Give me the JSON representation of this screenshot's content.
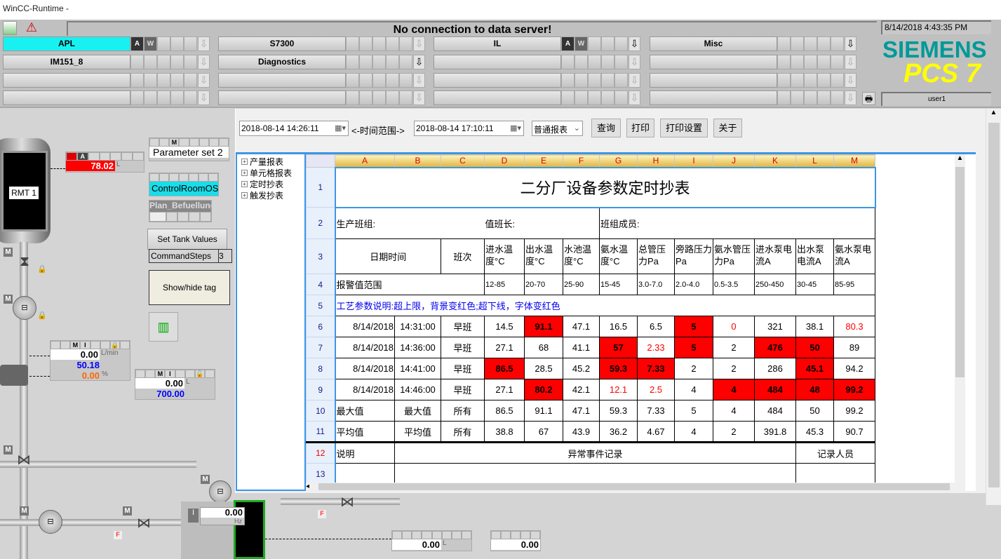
{
  "window": {
    "title": "WinCC-Runtime -"
  },
  "header": {
    "message": "No connection to data server!",
    "datetime": "8/14/2018 4:43:35 PM",
    "logo_brand": "SIEMENS",
    "logo_product": "PCS 7",
    "user": "user1",
    "accent_color": "#19f1f1",
    "groups": [
      [
        {
          "label": "APL",
          "active": true,
          "aw": true,
          "arrow_on": false
        },
        {
          "label": "IM151_8"
        },
        {
          "label": ""
        },
        {
          "label": ""
        }
      ],
      [
        {
          "label": "S7300"
        },
        {
          "label": "Diagnostics",
          "arrow_on": true
        },
        {
          "label": ""
        },
        {
          "label": ""
        }
      ],
      [
        {
          "label": "IL",
          "aw": true,
          "arrow_on": true
        },
        {
          "label": ""
        },
        {
          "label": ""
        },
        {
          "label": ""
        }
      ],
      [
        {
          "label": "Misc",
          "arrow_on": true
        },
        {
          "label": ""
        },
        {
          "label": ""
        },
        {
          "label": ""
        }
      ]
    ]
  },
  "hmi": {
    "tank_label": "RMT 1",
    "level_value": "78.02",
    "level_unit": "L",
    "parameter_set": "Parameter set 2",
    "control_room": "ControlRoomOS",
    "plan": "Plan_Befuellung",
    "set_tank_values": "Set Tank Values",
    "command_steps_label": "CommandSteps",
    "command_steps_value": "3",
    "show_hide_tag": "Show/hide tag",
    "flow": {
      "pv": "0.00",
      "sp": "50.18",
      "out": "0.00",
      "unit": "L/min",
      "out_unit": "%"
    },
    "volume": {
      "pv": "0.00",
      "sp": "700.00",
      "unit": "L"
    },
    "freq": {
      "value": "0.00",
      "unit": "Hz"
    },
    "bottom1": {
      "value": "0.00",
      "unit": "L"
    },
    "bottom2": {
      "value": "0.00"
    }
  },
  "report": {
    "start_time": "2018-08-14 14:26:11",
    "range_label": "<-时间范围->",
    "end_time": "2018-08-14 17:10:11",
    "report_type": "普通报表",
    "buttons": {
      "query": "查询",
      "print": "打印",
      "print_setup": "打印设置",
      "about": "关于"
    },
    "tree": [
      "产量报表",
      "单元格报表",
      "定时抄表",
      "触发抄表"
    ],
    "columns": [
      "A",
      "B",
      "C",
      "D",
      "E",
      "F",
      "G",
      "H",
      "I",
      "J",
      "K",
      "L",
      "M"
    ],
    "title": "二分厂设备参数定时抄表",
    "row2": {
      "group": "生产班组:",
      "leader": "值班长:",
      "members": "班组成员:"
    },
    "row3": {
      "datetime": "日期时间",
      "shift": "班次",
      "params": [
        "进水温度°C",
        "出水温度°C",
        "水池温度°C",
        "氨水温度°C",
        "总管压力Pa",
        "旁路压力Pa",
        "氨水管压力Pa",
        "进水泵电流A",
        "出水泵电流A",
        "氨水泵电流A"
      ]
    },
    "row4": {
      "label": "报警值范围",
      "ranges": [
        "12-85",
        "20-70",
        "25-90",
        "15-45",
        "3.0-7.0",
        "2.0-4.0",
        "0.5-3.5",
        "250-450",
        "30-45",
        "85-95"
      ]
    },
    "row5": {
      "note": "工艺参数说明:超上限，背景变红色;超下线，字体变红色"
    },
    "data_rows": [
      {
        "date": "8/14/2018",
        "time": "14:31:00",
        "shift": "早班",
        "values": [
          {
            "v": "14.5"
          },
          {
            "v": "91.1",
            "s": "hi"
          },
          {
            "v": "47.1"
          },
          {
            "v": "16.5"
          },
          {
            "v": "6.5"
          },
          {
            "v": "5",
            "s": "hi"
          },
          {
            "v": "0",
            "s": "lo"
          },
          {
            "v": "321"
          },
          {
            "v": "38.1"
          },
          {
            "v": "80.3",
            "s": "lo"
          }
        ]
      },
      {
        "date": "8/14/2018",
        "time": "14:36:00",
        "shift": "早班",
        "values": [
          {
            "v": "27.1"
          },
          {
            "v": "68"
          },
          {
            "v": "41.1"
          },
          {
            "v": "57",
            "s": "hi"
          },
          {
            "v": "2.33",
            "s": "lo"
          },
          {
            "v": "5",
            "s": "hi"
          },
          {
            "v": "2"
          },
          {
            "v": "476",
            "s": "hi"
          },
          {
            "v": "50",
            "s": "hi"
          },
          {
            "v": "89"
          }
        ]
      },
      {
        "date": "8/14/2018",
        "time": "14:41:00",
        "shift": "早班",
        "values": [
          {
            "v": "86.5",
            "s": "hi"
          },
          {
            "v": "28.5"
          },
          {
            "v": "45.2"
          },
          {
            "v": "59.3",
            "s": "hi"
          },
          {
            "v": "7.33",
            "s": "hi"
          },
          {
            "v": "2"
          },
          {
            "v": "2"
          },
          {
            "v": "286"
          },
          {
            "v": "45.1",
            "s": "hi"
          },
          {
            "v": "94.2"
          }
        ]
      },
      {
        "date": "8/14/2018",
        "time": "14:46:00",
        "shift": "早班",
        "values": [
          {
            "v": "27.1"
          },
          {
            "v": "80.2",
            "s": "hi"
          },
          {
            "v": "42.1"
          },
          {
            "v": "12.1",
            "s": "lo"
          },
          {
            "v": "2.5",
            "s": "lo"
          },
          {
            "v": "4"
          },
          {
            "v": "4",
            "s": "hi"
          },
          {
            "v": "484",
            "s": "hi"
          },
          {
            "v": "48",
            "s": "hi"
          },
          {
            "v": "99.2",
            "s": "hi"
          }
        ]
      }
    ],
    "summary_rows": [
      {
        "a": "最大值",
        "b": "最大值",
        "c": "所有",
        "values": [
          "86.5",
          "91.1",
          "47.1",
          "59.3",
          "7.33",
          "5",
          "4",
          "484",
          "50",
          "99.2"
        ]
      },
      {
        "a": "平均值",
        "b": "平均值",
        "c": "所有",
        "values": [
          "38.8",
          "67",
          "43.9",
          "36.2",
          "4.67",
          "4",
          "2",
          "391.8",
          "45.3",
          "90.7"
        ]
      }
    ],
    "row12": {
      "note": "说明",
      "events": "异常事件记录",
      "recorder": "记录人员"
    },
    "row_numbers": [
      "1",
      "2",
      "3",
      "4",
      "5",
      "6",
      "7",
      "8",
      "9",
      "10",
      "11",
      "12",
      "13"
    ],
    "high_color": "#ff0000",
    "low_color": "#ff0000"
  }
}
